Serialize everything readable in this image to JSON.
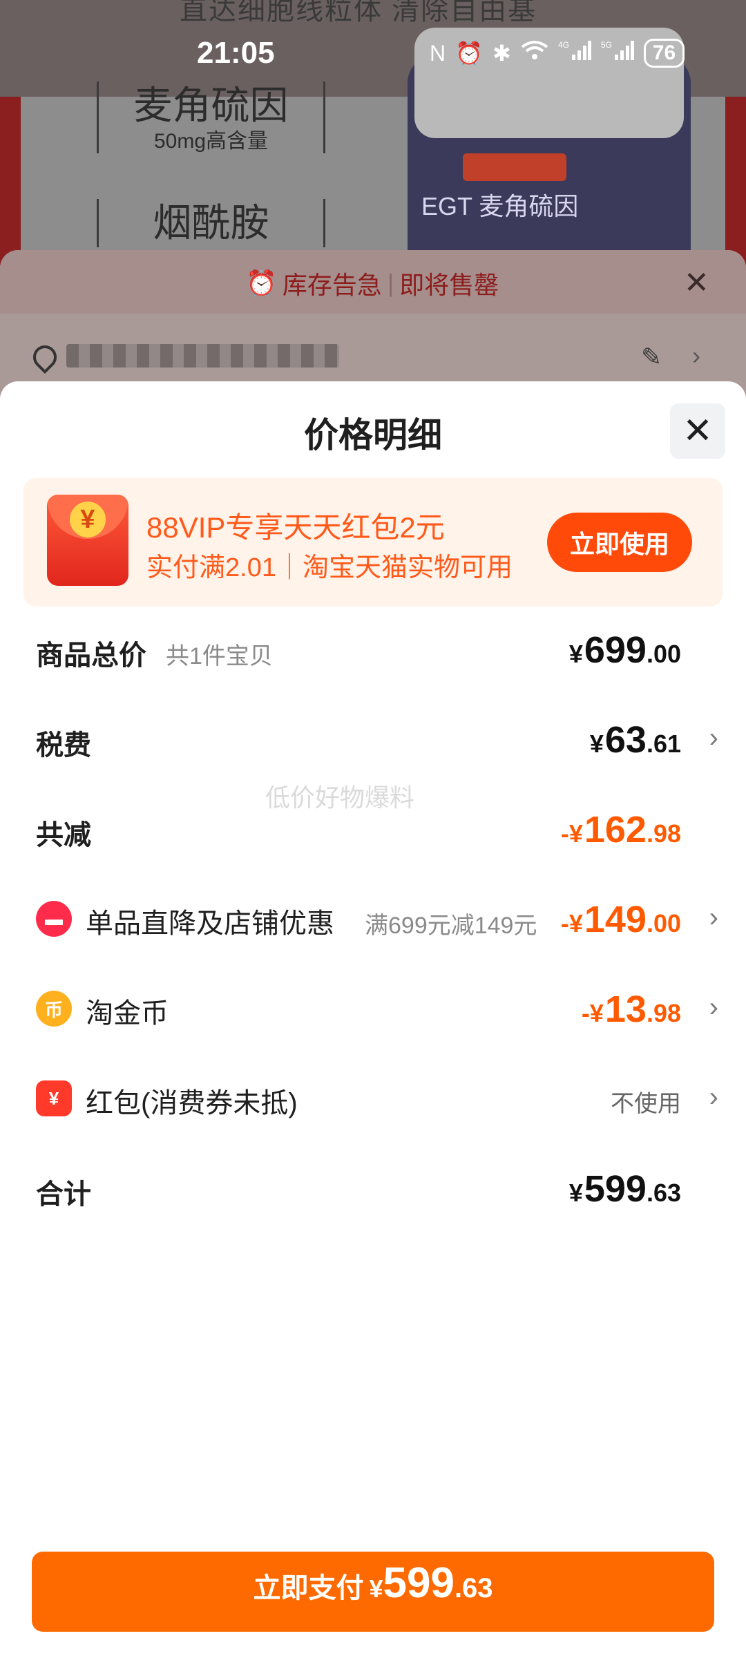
{
  "status_bar": {
    "time": "21:05",
    "icons": [
      "nfc-icon",
      "alarm-icon",
      "bluetooth-icon",
      "wifi-icon",
      "signal-4g-icon",
      "signal-5g-icon"
    ],
    "battery": "76"
  },
  "background": {
    "caption": "直达细胞线粒体 清除自由基",
    "box1_big": "麦角硫因",
    "box1_small": "50mg高含量",
    "box2_big": "烟酰胺",
    "bottle_label": "EGT 麦角硫因"
  },
  "stock_alert": {
    "left": "库存告急",
    "right": "即将售罄"
  },
  "sheet": {
    "title": "价格明细",
    "promo": {
      "title": "88VIP专享天天红包2元",
      "subtitle": "实付满2.01｜淘宝天猫实物可用",
      "button": "立即使用",
      "icon_glyph": "¥"
    },
    "rows": {
      "total_price": {
        "label": "商品总价",
        "hint": "共1件宝贝",
        "currency": "¥",
        "int": "699",
        "dec": ".00"
      },
      "tax": {
        "label": "税费",
        "currency": "¥",
        "int": "63",
        "dec": ".61"
      },
      "total_discount": {
        "label": "共减",
        "currency": "-¥",
        "int": "162",
        "dec": ".98"
      },
      "store_discount": {
        "label": "单品直降及店铺优惠",
        "hint": "满699元减149元",
        "currency": "-¥",
        "int": "149",
        "dec": ".00"
      },
      "taojinbi": {
        "label": "淘金币",
        "currency": "-¥",
        "int": "13",
        "dec": ".98"
      },
      "redpacket": {
        "label": "红包(消费券未抵)",
        "value": "不使用"
      },
      "sum": {
        "label": "合计",
        "currency": "¥",
        "int": "599",
        "dec": ".63"
      }
    },
    "watermark": "低价好物爆料",
    "pay_button": {
      "label": "立即支付",
      "currency": "¥",
      "int": "599",
      "dec": ".63"
    }
  },
  "colors": {
    "accent_orange": "#ff6a00",
    "discount_orange": "#ff5a00",
    "promo_bg": "#fff3ea"
  }
}
